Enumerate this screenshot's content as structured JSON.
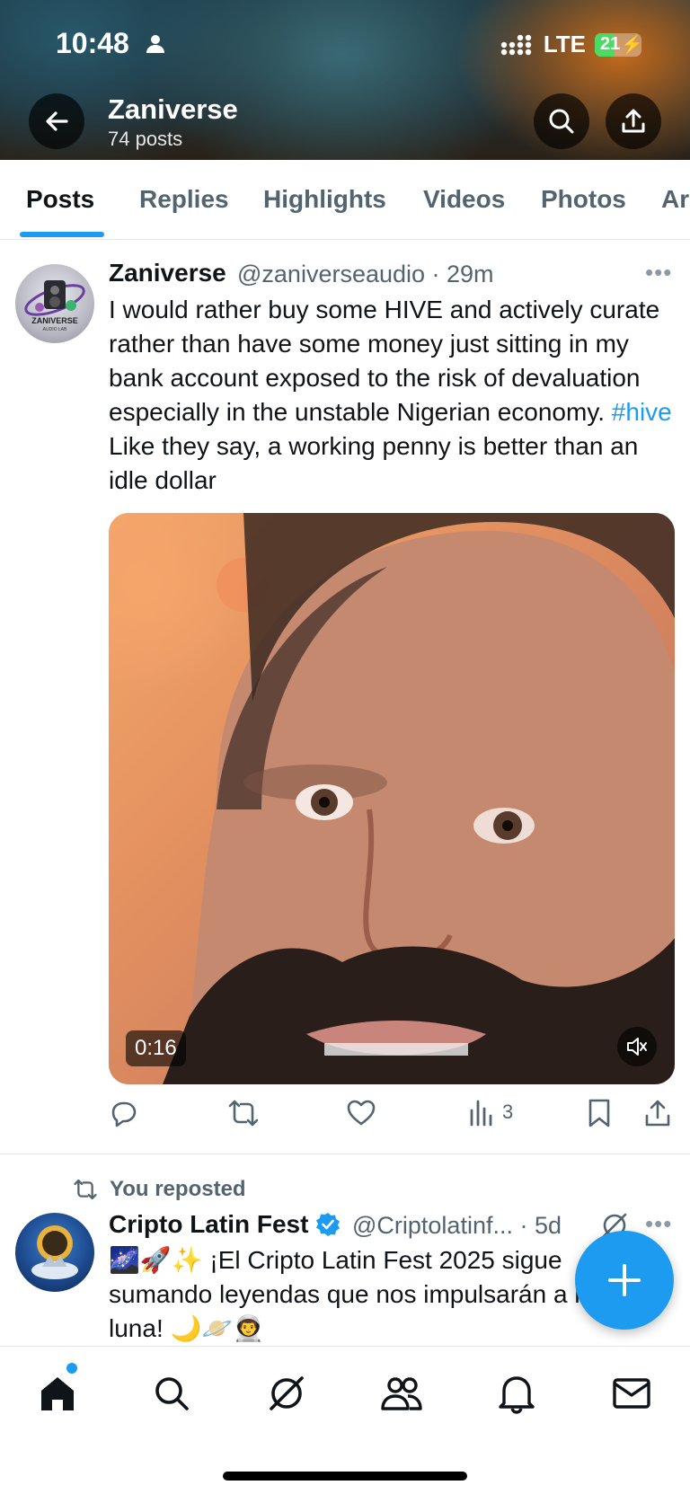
{
  "status_bar": {
    "time": "10:48",
    "network": "LTE",
    "battery": "21"
  },
  "header": {
    "name": "Zaniverse",
    "post_count": "74 posts"
  },
  "tabs": [
    {
      "label": "Posts",
      "active": true
    },
    {
      "label": "Replies"
    },
    {
      "label": "Highlights"
    },
    {
      "label": "Videos"
    },
    {
      "label": "Photos"
    },
    {
      "label": "Ar"
    }
  ],
  "post1": {
    "display_name": "Zaniverse",
    "handle_time": "@zaniverseaudio · 29m",
    "avatar_text": "ZANIVERSE",
    "avatar_sub": "AUDIO LAB",
    "text_before": "I would rather buy some HIVE and actively curate rather than have some money just sitting in my bank account exposed to the risk of devaluation especially in the unstable Nigerian economy. ",
    "hashtag": "#hive",
    "text_after": " Like they say, a working penny is better than an idle dollar",
    "video_duration": "0:16",
    "views": "3"
  },
  "post2": {
    "repost_label": "You reposted",
    "display_name": "Cripto Latin Fest",
    "handle_time": "@Criptolatinf... · 5d",
    "text": "🌌🚀✨ ¡El Cripto Latin Fest 2025 sigue sumando leyendas que nos impulsarán a la luna! 🌙🪐👨‍🚀"
  },
  "colors": {
    "accent": "#1d9bf0",
    "text": "#0f1419",
    "secondary": "#536471"
  }
}
